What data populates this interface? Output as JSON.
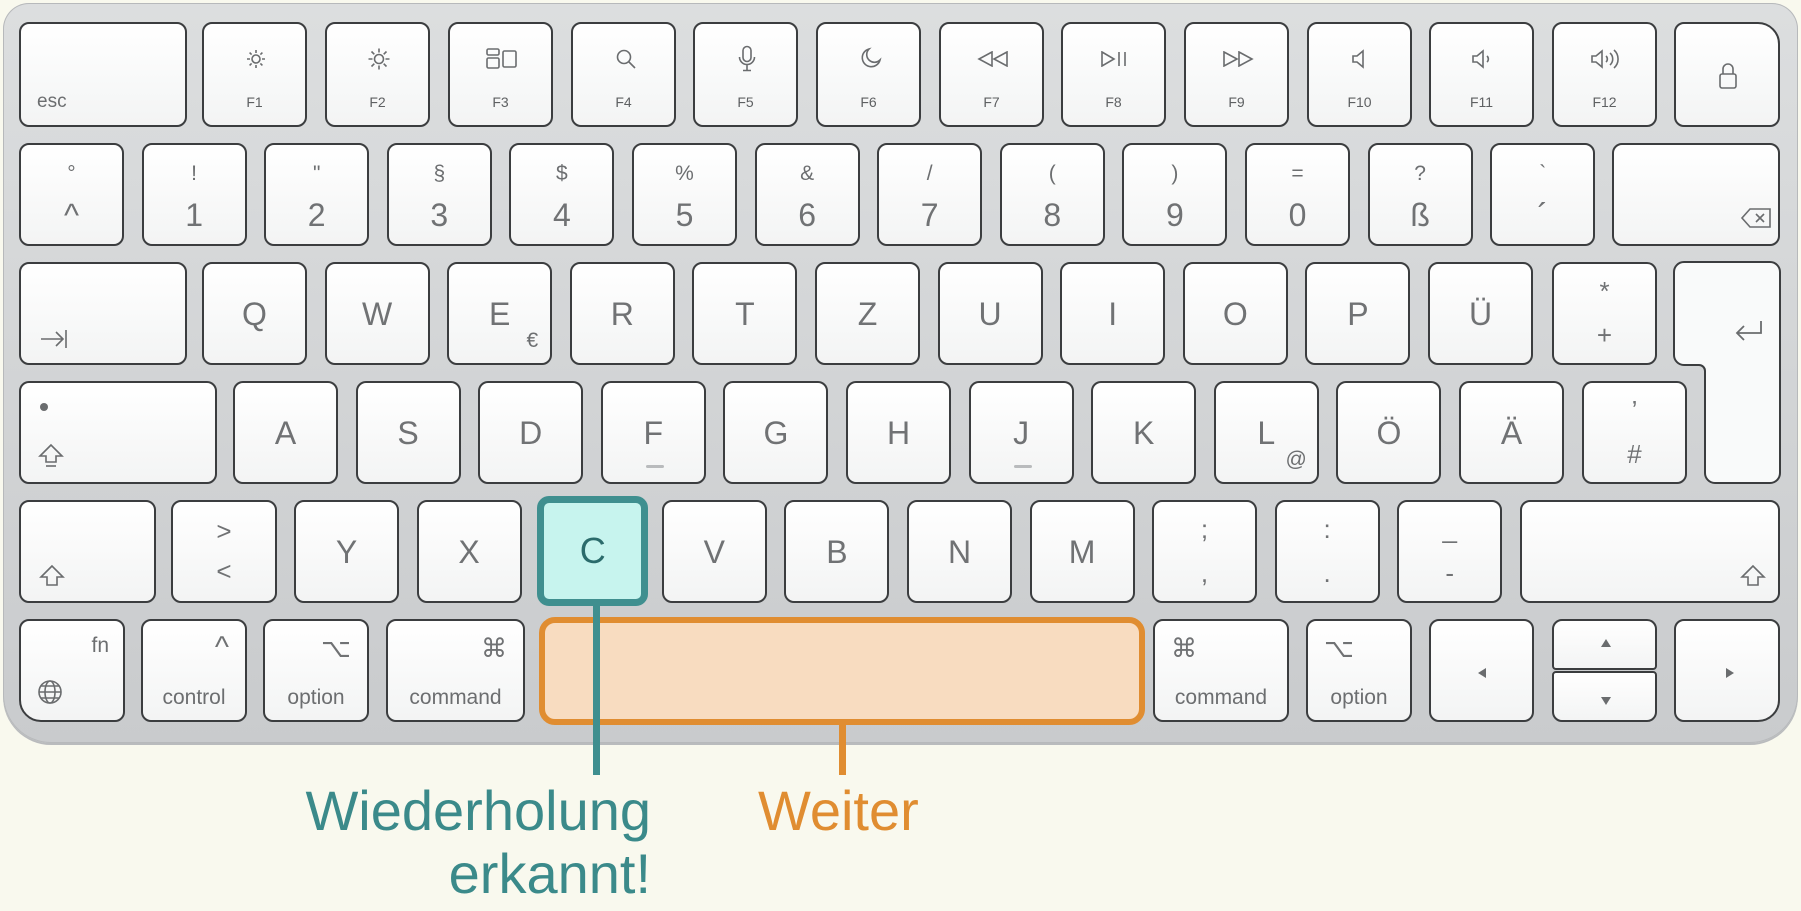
{
  "keyboard": {
    "row_fn": {
      "esc": "esc",
      "f1": "F1",
      "f2": "F2",
      "f3": "F3",
      "f4": "F4",
      "f5": "F5",
      "f6": "F6",
      "f7": "F7",
      "f8": "F8",
      "f9": "F9",
      "f10": "F10",
      "f11": "F11",
      "f12": "F12"
    },
    "row_num": [
      {
        "top": "°",
        "bottom": "^"
      },
      {
        "top": "!",
        "bottom": "1"
      },
      {
        "top": "\"",
        "bottom": "2"
      },
      {
        "top": "§",
        "bottom": "3"
      },
      {
        "top": "$",
        "bottom": "4"
      },
      {
        "top": "%",
        "bottom": "5"
      },
      {
        "top": "&",
        "bottom": "6"
      },
      {
        "top": "/",
        "bottom": "7"
      },
      {
        "top": "(",
        "bottom": "8"
      },
      {
        "top": ")",
        "bottom": "9"
      },
      {
        "top": "=",
        "bottom": "0"
      },
      {
        "top": "?",
        "bottom": "ß"
      },
      {
        "top": "`",
        "bottom": "´"
      }
    ],
    "row_q": [
      "Q",
      "W",
      "E",
      "R",
      "T",
      "Z",
      "U",
      "I",
      "O",
      "P",
      "Ü"
    ],
    "e_alt": "€",
    "plus_key": {
      "top": "*",
      "bottom": "+"
    },
    "row_a": [
      "A",
      "S",
      "D",
      "F",
      "G",
      "H",
      "J",
      "K",
      "L",
      "Ö",
      "Ä"
    ],
    "l_alt": "@",
    "hash_key": {
      "top": "’",
      "bottom": "#"
    },
    "angle_key": {
      "top": ">",
      "bottom": "<"
    },
    "row_y": [
      "Y",
      "X",
      "C",
      "V",
      "B",
      "N",
      "M"
    ],
    "punct_keys": [
      {
        "top": ";",
        "bottom": ","
      },
      {
        "top": ":",
        "bottom": "."
      },
      {
        "top": "_",
        "bottom": "-"
      }
    ],
    "bottom_row": {
      "fn": "fn",
      "control": "control",
      "control_symbol": "^",
      "option_left": "option",
      "option_symbol": "⌥",
      "command_left": "command",
      "command_symbol": "⌘",
      "command_right": "command",
      "option_right": "option"
    }
  },
  "annotations": {
    "repeat_label_line1": "Wiederholung",
    "repeat_label_line2": "erkannt!",
    "continue_label": "Weiter",
    "teal_color": "#3b8a8a",
    "orange_color": "#e08d31"
  }
}
